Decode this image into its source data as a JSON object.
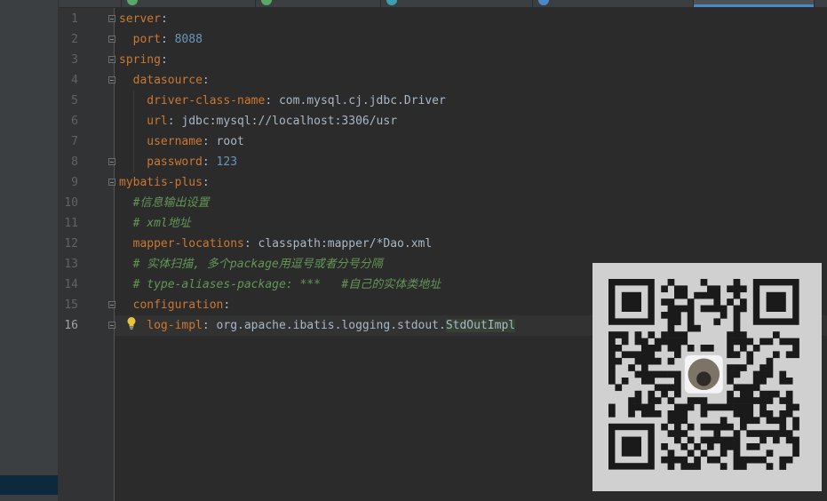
{
  "colors": {
    "key": "#cc7832",
    "value": "#a9b7c6",
    "number": "#6897bb",
    "comment": "#629755",
    "background": "#2b2b2b",
    "gutter": "#313335",
    "accent": "#4a88c7"
  },
  "editor": {
    "line_numbers": [
      "1",
      "2",
      "3",
      "4",
      "5",
      "6",
      "7",
      "8",
      "9",
      "10",
      "11",
      "12",
      "13",
      "14",
      "15",
      "16"
    ],
    "current_line": "16",
    "lines": [
      {
        "key": "server",
        "sep": ":",
        "value": ""
      },
      {
        "key": "port",
        "sep": ": ",
        "value": "8088"
      },
      {
        "key": "spring",
        "sep": ":",
        "value": ""
      },
      {
        "key": "datasource",
        "sep": ":",
        "value": ""
      },
      {
        "key": "driver-class-name",
        "sep": ": ",
        "value": "com.mysql.cj.jdbc.Driver"
      },
      {
        "key": "url",
        "sep": ": ",
        "value": "jdbc:mysql://localhost:3306/usr"
      },
      {
        "key": "username",
        "sep": ": ",
        "value": "root"
      },
      {
        "key": "password",
        "sep": ": ",
        "value": "123"
      },
      {
        "key": "mybatis-plus",
        "sep": ":",
        "value": ""
      },
      {
        "comment": "#信息输出设置"
      },
      {
        "comment": "# xml地址"
      },
      {
        "key": "mapper-locations",
        "sep": ": ",
        "value": "classpath:mapper/*Dao.xml"
      },
      {
        "comment": "# 实体扫描, 多个package用逗号或者分号分隔"
      },
      {
        "comment": "# type-aliases-package: ***   #自己的实体类地址"
      },
      {
        "key": "configuration",
        "sep": ":",
        "value": ""
      },
      {
        "key": "log-impl",
        "sep": ": ",
        "value_pre": "org.apache.ibatis.logging.stdout.",
        "value_hl": "StdOutImpl"
      }
    ]
  },
  "icons": {
    "intention": "lightbulb-icon",
    "fold": "fold-marker-icon",
    "qr": "qr-code"
  }
}
